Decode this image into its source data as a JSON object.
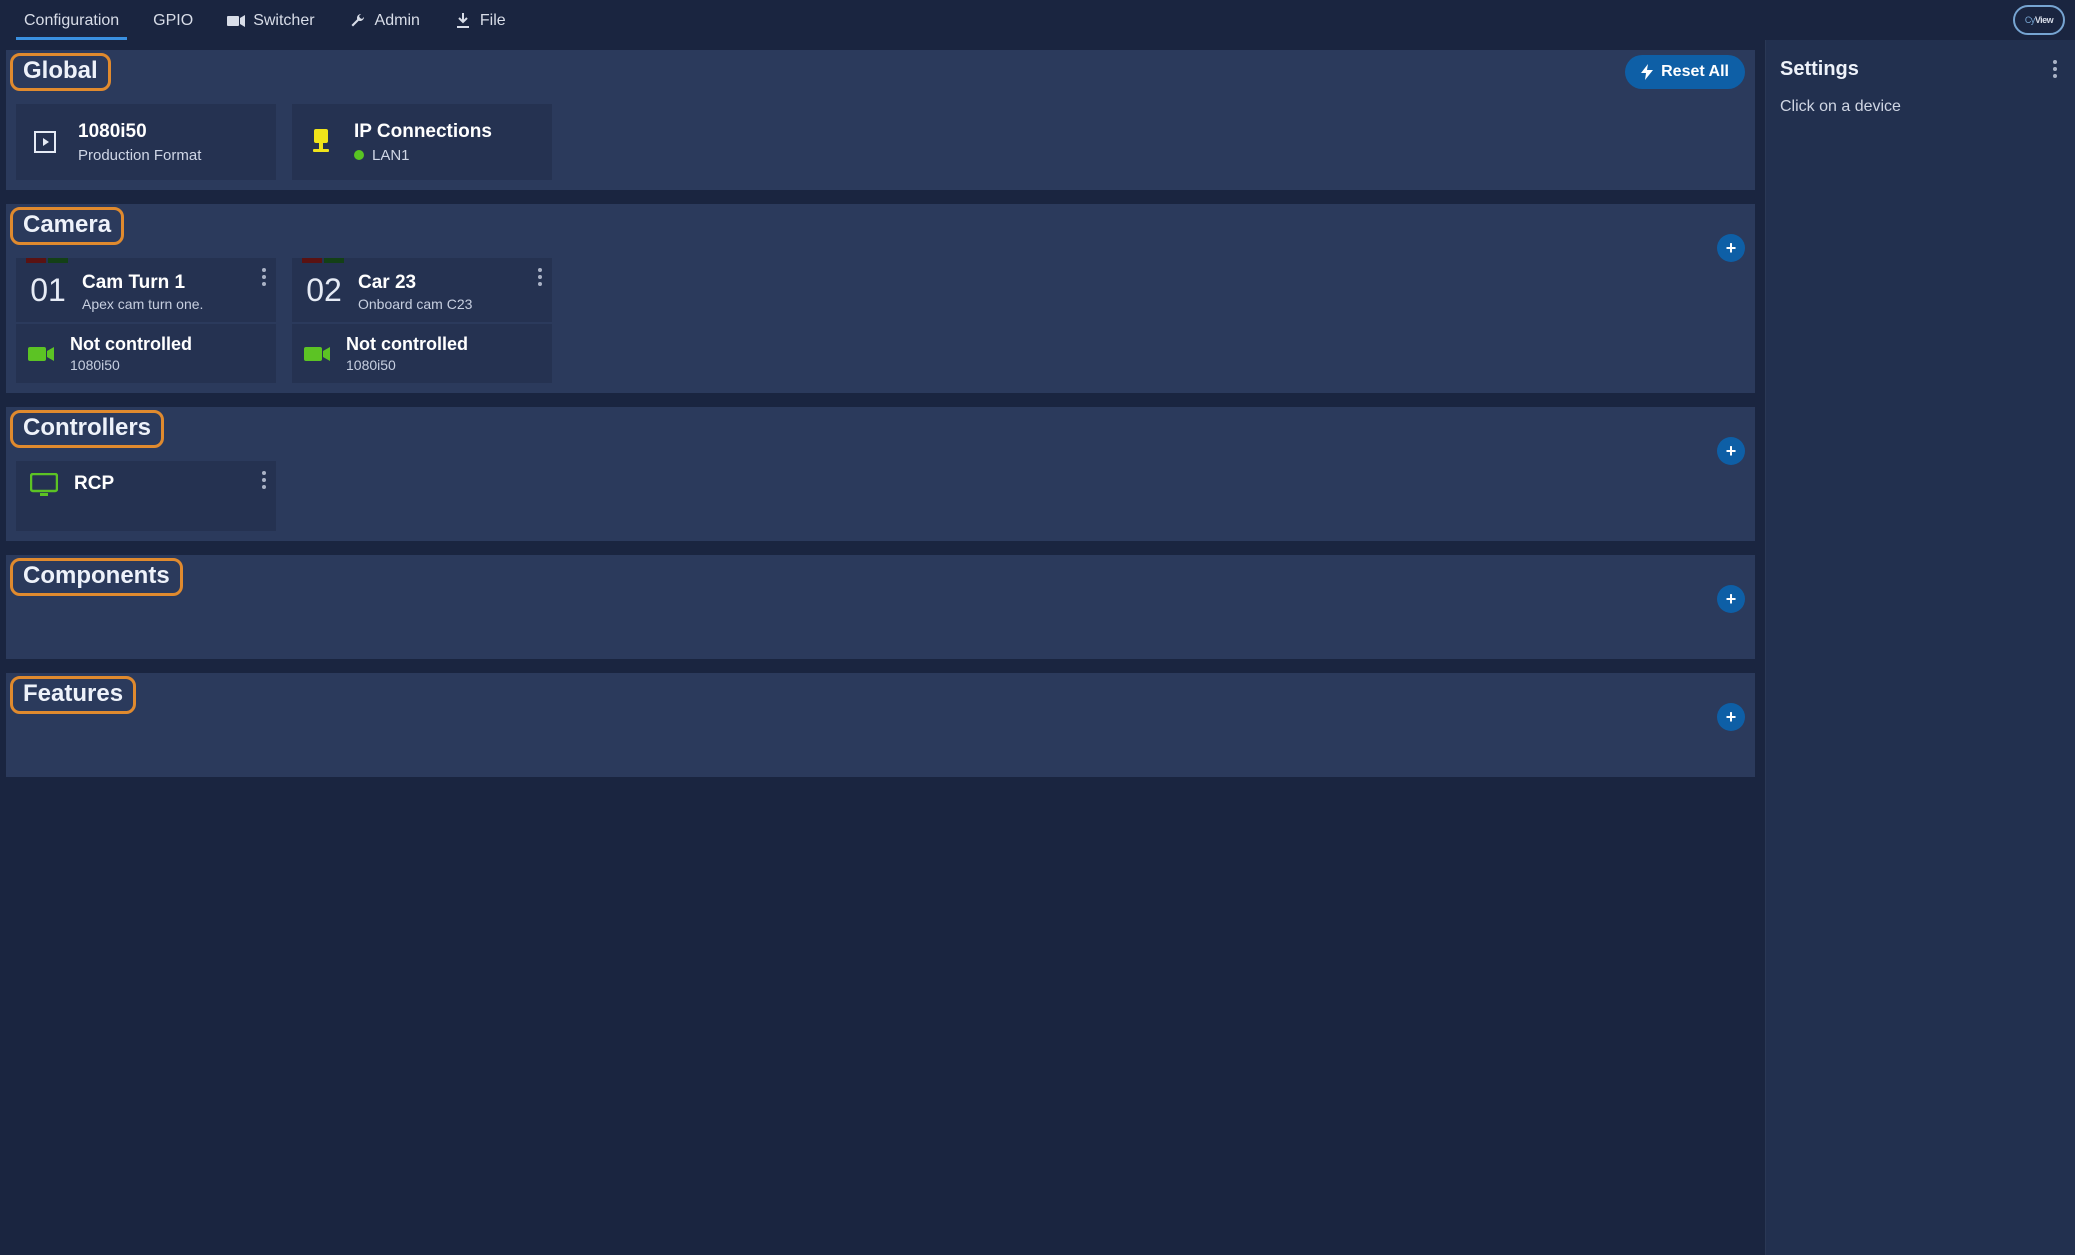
{
  "nav": {
    "items": [
      {
        "label": "Configuration",
        "active": true
      },
      {
        "label": "GPIO",
        "active": false
      },
      {
        "label": "Switcher",
        "active": false
      },
      {
        "label": "Admin",
        "active": false
      },
      {
        "label": "File",
        "active": false
      }
    ],
    "logo_a": "Cy",
    "logo_b": "View"
  },
  "side": {
    "title": "Settings",
    "sub": "Click on a device"
  },
  "sections": {
    "global": {
      "title": "Global",
      "reset": "Reset All",
      "cards": [
        {
          "title": "1080i50",
          "sub": "Production Format"
        },
        {
          "title": "IP Connections",
          "sub": "LAN1"
        }
      ]
    },
    "camera": {
      "title": "Camera",
      "cams": [
        {
          "num": "01",
          "title": "Cam Turn 1",
          "sub": "Apex cam turn one.",
          "state": "Not controlled",
          "fmt": "1080i50"
        },
        {
          "num": "02",
          "title": "Car 23",
          "sub": "Onboard cam C23",
          "state": "Not controlled",
          "fmt": "1080i50"
        }
      ]
    },
    "controllers": {
      "title": "Controllers",
      "items": [
        {
          "title": "RCP"
        }
      ]
    },
    "components": {
      "title": "Components"
    },
    "features": {
      "title": "Features"
    }
  }
}
